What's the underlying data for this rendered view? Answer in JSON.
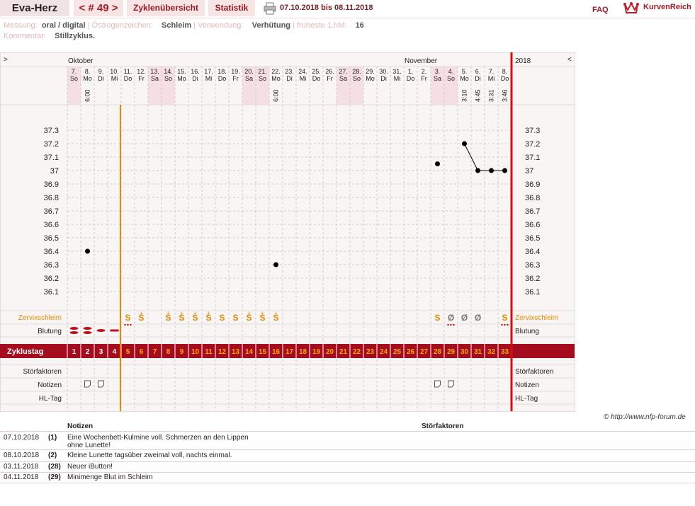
{
  "nav": {
    "title": "Eva-Herz",
    "cycle": "< # 49 >",
    "overview": "Zyklenübersicht",
    "stats": "Statistik",
    "daterange": "07.10.2018 bis 08.11.2018",
    "faq": "FAQ",
    "logo": "KurvenReich"
  },
  "meta": {
    "measurement_label": "Messung:",
    "measurement_value": "oral / digital",
    "estrogen_label": "Östrogenzeichen:",
    "estrogen_value": "Schleim",
    "usage_label": "Verwendung:",
    "usage_value": "Verhütung",
    "earliest_label": "früheste 1.hM:",
    "earliest_value": "16",
    "comment_label": "Kommentar:",
    "comment_value": "Stillzyklus."
  },
  "chart": {
    "left_arrow": ">",
    "right_arrow": "<",
    "month1": "Oktober",
    "month2": "November",
    "year": "2018",
    "colors": {
      "dark_red": "#a50d1f",
      "orange": "#e88a00",
      "weekend": "#f5dfe3",
      "grid": "#cccccc",
      "vline_orange": "#e88a00",
      "vline_red": "#cc1111"
    }
  },
  "chart_data": {
    "type": "line",
    "days": [
      {
        "d": "7.",
        "w": "So",
        "time": "",
        "we": true
      },
      {
        "d": "8.",
        "w": "Mo",
        "time": "6:00",
        "we": false
      },
      {
        "d": "9.",
        "w": "Di",
        "time": "",
        "we": false
      },
      {
        "d": "10.",
        "w": "Mi",
        "time": "",
        "we": false
      },
      {
        "d": "11.",
        "w": "Do",
        "time": "",
        "we": false
      },
      {
        "d": "12.",
        "w": "Fr",
        "time": "",
        "we": false
      },
      {
        "d": "13.",
        "w": "Sa",
        "time": "",
        "we": true
      },
      {
        "d": "14.",
        "w": "So",
        "time": "",
        "we": true
      },
      {
        "d": "15.",
        "w": "Mo",
        "time": "",
        "we": false
      },
      {
        "d": "16.",
        "w": "Di",
        "time": "",
        "we": false
      },
      {
        "d": "17.",
        "w": "Mi",
        "time": "",
        "we": false
      },
      {
        "d": "18.",
        "w": "Do",
        "time": "",
        "we": false
      },
      {
        "d": "19.",
        "w": "Fr",
        "time": "",
        "we": false
      },
      {
        "d": "20.",
        "w": "Sa",
        "time": "",
        "we": true
      },
      {
        "d": "21.",
        "w": "So",
        "time": "",
        "we": true
      },
      {
        "d": "22.",
        "w": "Mo",
        "time": "6:00",
        "we": false
      },
      {
        "d": "23.",
        "w": "Di",
        "time": "",
        "we": false
      },
      {
        "d": "24.",
        "w": "Mi",
        "time": "",
        "we": false
      },
      {
        "d": "25.",
        "w": "Do",
        "time": "",
        "we": false
      },
      {
        "d": "26.",
        "w": "Fr",
        "time": "",
        "we": false
      },
      {
        "d": "27.",
        "w": "Sa",
        "time": "",
        "we": true
      },
      {
        "d": "28.",
        "w": "So",
        "time": "",
        "we": true
      },
      {
        "d": "29.",
        "w": "Mo",
        "time": "",
        "we": false
      },
      {
        "d": "30.",
        "w": "Di",
        "time": "",
        "we": false
      },
      {
        "d": "31.",
        "w": "Mi",
        "time": "",
        "we": false
      },
      {
        "d": "1.",
        "w": "Do",
        "time": "",
        "we": false
      },
      {
        "d": "2.",
        "w": "Fr",
        "time": "",
        "we": false
      },
      {
        "d": "3.",
        "w": "Sa",
        "time": "",
        "we": true
      },
      {
        "d": "4.",
        "w": "So",
        "time": "",
        "we": true
      },
      {
        "d": "5.",
        "w": "Mo",
        "time": "3:10",
        "we": false
      },
      {
        "d": "6.",
        "w": "Di",
        "time": "4:45",
        "we": false
      },
      {
        "d": "7.",
        "w": "Mi",
        "time": "3:31",
        "we": false
      },
      {
        "d": "8.",
        "w": "Do",
        "time": "3:46",
        "we": false
      }
    ],
    "y_ticks": [
      37.3,
      37.2,
      37.1,
      37,
      36.9,
      36.8,
      36.7,
      36.6,
      36.5,
      36.4,
      36.3,
      36.2,
      36.1
    ],
    "ylim": [
      36.1,
      37.3
    ],
    "temperatures": [
      {
        "day": 2,
        "t": 36.4,
        "connected": false
      },
      {
        "day": 16,
        "t": 36.3,
        "connected": false
      },
      {
        "day": 28,
        "t": 37.05,
        "connected": false
      },
      {
        "day": 30,
        "t": 37.2,
        "connected": true
      },
      {
        "day": 31,
        "t": 37.0,
        "connected": true
      },
      {
        "day": 32,
        "t": 37.0,
        "connected": true
      },
      {
        "day": 33,
        "t": 37.0,
        "connected": true
      }
    ],
    "cervical_mucus": [
      "",
      "",
      "",
      "",
      "S",
      "S+",
      "",
      "S+",
      "S+",
      "S+",
      "S+",
      "S",
      "S",
      "S+",
      "S+",
      "S+",
      "",
      "",
      "",
      "",
      "",
      "",
      "",
      "",
      "",
      "",
      "",
      "S",
      "Ø",
      "Ø",
      "Ø",
      "",
      "S"
    ],
    "bleeding": [
      "heavy",
      "heavy",
      "medium",
      "light",
      "spot",
      "",
      "",
      "",
      "",
      "",
      "",
      "",
      "",
      "",
      "",
      "",
      "",
      "",
      "",
      "",
      "",
      "",
      "",
      "",
      "",
      "",
      "",
      "",
      "spot",
      "",
      "",
      "",
      "spot"
    ],
    "notes": [
      false,
      true,
      true,
      false,
      false,
      false,
      false,
      false,
      false,
      false,
      false,
      false,
      false,
      false,
      false,
      false,
      false,
      false,
      false,
      false,
      false,
      false,
      false,
      false,
      false,
      false,
      false,
      true,
      true,
      false,
      false,
      false,
      false
    ],
    "cycle_days": [
      "1",
      "2",
      "3",
      "4",
      "5",
      "6",
      "7",
      "8",
      "9",
      "10",
      "11",
      "12",
      "13",
      "14",
      "15",
      "16",
      "17",
      "18",
      "19",
      "20",
      "21",
      "22",
      "23",
      "24",
      "25",
      "26",
      "27",
      "28",
      "29",
      "30",
      "31",
      "32",
      "33"
    ],
    "row_labels": {
      "mucus": "Zervixschleim",
      "bleeding": "Blutung",
      "cycleday": "Zyklustag",
      "disturb": "Störfaktoren",
      "notes": "Notizen",
      "hl": "HL-Tag"
    },
    "mucus_symbols": {
      "S": "S",
      "S+": "S",
      "Ø": "Ø"
    }
  },
  "notes_table": {
    "copyright": "© http://www.nfp-forum.de",
    "col_notes": "Notizen",
    "col_disturb": "Störfaktoren",
    "rows": [
      {
        "date": "07.10.2018",
        "day": "(1)",
        "text": "Eine Wochenbett-Kulmine voll. Schmerzen an den Lippen",
        "text2": "ohne Lunette!"
      },
      {
        "date": "08.10.2018",
        "day": "(2)",
        "text": "Kleine Lunette tagsüber zweimal voll, nachts einmal.",
        "text2": ""
      },
      {
        "date": "03.11.2018",
        "day": "(28)",
        "text": "Neuer iButton!",
        "text2": ""
      },
      {
        "date": "04.11.2018",
        "day": "(29)",
        "text": "Minimenge Blut im Schleim",
        "text2": ""
      }
    ]
  }
}
